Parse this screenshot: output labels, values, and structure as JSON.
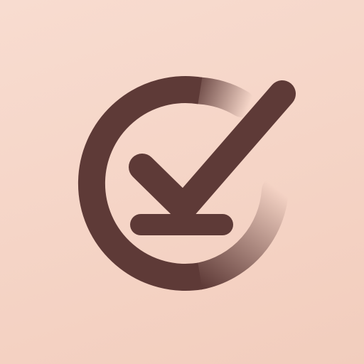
{
  "icon": {
    "name": "download-check-icon",
    "colors": {
      "background_top": "#f8dcd0",
      "background_bottom": "#f2cdbd",
      "glyph": "#5e3a37"
    }
  }
}
